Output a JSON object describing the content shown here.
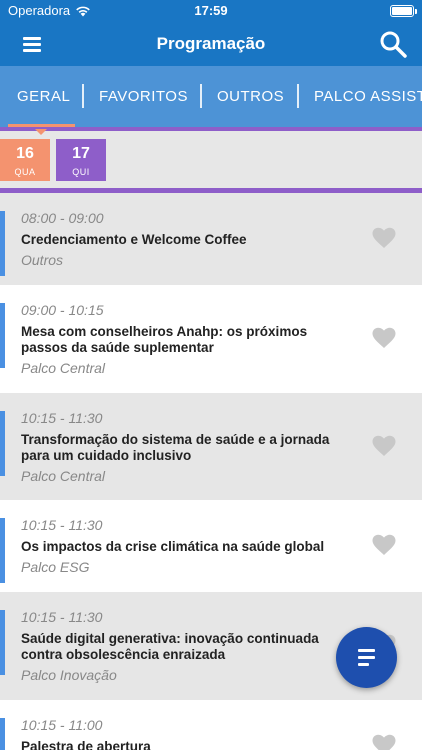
{
  "status": {
    "carrier": "Operadora",
    "time": "17:59"
  },
  "header": {
    "title": "Programação"
  },
  "tabs": [
    {
      "label": "GERAL"
    },
    {
      "label": "FAVORITOS"
    },
    {
      "label": "OUTROS"
    },
    {
      "label": "PALCO ASSIST"
    }
  ],
  "dates": [
    {
      "day": "16",
      "weekday": "QUA",
      "color": "#f4936f"
    },
    {
      "day": "17",
      "weekday": "QUI",
      "color": "#8e5ec9"
    }
  ],
  "items": [
    {
      "time": "08:00 - 09:00",
      "title": "Credenciamento e Welcome Coffee",
      "venue": "Outros"
    },
    {
      "time": "09:00 - 10:15",
      "title": "Mesa com conselheiros Anahp: os próximos passos da saúde suplementar",
      "venue": "Palco Central"
    },
    {
      "time": "10:15 - 11:30",
      "title": "Transformação do sistema de saúde e a jornada para um cuidado inclusivo",
      "venue": "Palco Central"
    },
    {
      "time": "10:15 - 11:30",
      "title": "Os impactos da crise climática na saúde global",
      "venue": "Palco ESG"
    },
    {
      "time": "10:15 - 11:30",
      "title": "Saúde digital generativa: inovação continuada contra obsolescência enraizada",
      "venue": "Palco Inovação"
    },
    {
      "time": "10:15 - 11:00",
      "title": "Palestra de abertura",
      "venue": ""
    }
  ],
  "colors": {
    "primary": "#1976c4",
    "tab_bg": "#4d93d6",
    "accent": "#4a90e2",
    "fab": "#1e4fae",
    "heart": "#c8c8c8"
  }
}
